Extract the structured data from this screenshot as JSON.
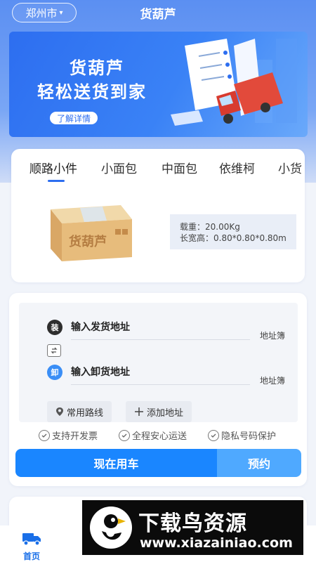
{
  "header": {
    "city": "郑州市",
    "title": "货葫芦"
  },
  "banner": {
    "line1": "货葫芦",
    "line2": "轻松送货到家",
    "button": "了解详情"
  },
  "vehicle_tabs": [
    {
      "label": "顺路小件",
      "active": true
    },
    {
      "label": "小面包",
      "active": false
    },
    {
      "label": "中面包",
      "active": false
    },
    {
      "label": "依维柯",
      "active": false
    },
    {
      "label": "小货",
      "active": false
    }
  ],
  "vehicle": {
    "box_text": "货葫芦",
    "load_label": "载重：20.00Kg",
    "size_label": "长宽高：0.80*0.80*0.80m"
  },
  "order": {
    "load_badge": "装",
    "unload_badge": "卸",
    "load_address": "输入发货地址",
    "unload_address": "输入卸货地址",
    "address_book": "地址簿",
    "common_routes": "常用路线",
    "add_address": "添加地址",
    "features": [
      "支持开发票",
      "全程安心运送",
      "隐私号码保护"
    ],
    "now_button": "现在用车",
    "book_button": "预约"
  },
  "tabbar": {
    "home": "首页"
  },
  "watermark": {
    "title": "下载鸟资源",
    "url": "www.xiazainiao.com"
  },
  "colors": {
    "primary": "#1a86ff",
    "secondary": "#4fa9ff",
    "header_gradient_top": "#5b8ff2"
  }
}
